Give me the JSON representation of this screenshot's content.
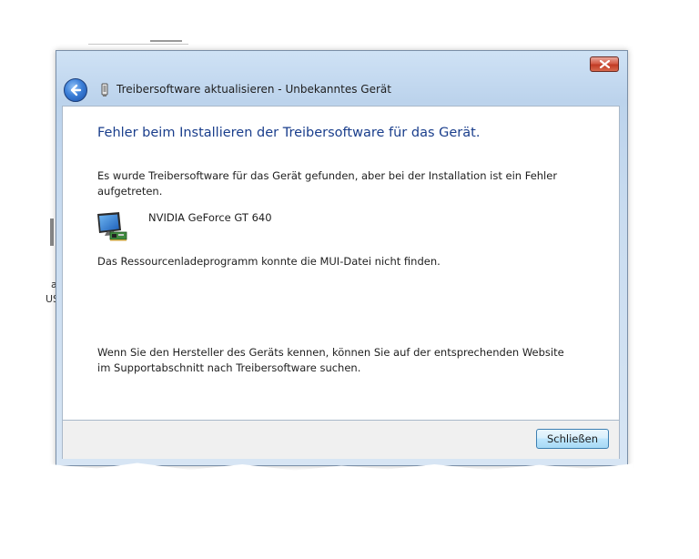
{
  "window": {
    "title": "Treibersoftware aktualisieren - Unbekanntes Gerät"
  },
  "background": {
    "fragment_a": "a",
    "fragment_b": "US"
  },
  "content": {
    "heading": "Fehler beim Installieren der Treibersoftware für das Gerät.",
    "intro": "Es wurde Treibersoftware für das Gerät gefunden, aber bei der Installation ist ein Fehler aufgetreten.",
    "device_name": "NVIDIA GeForce GT 640",
    "error_message": "Das Ressourcenladeprogramm konnte die MUI-Datei nicht finden.",
    "help_text": "Wenn Sie den Hersteller des Geräts kennen, können Sie auf der entsprechenden Website im Supportabschnitt nach Treibersoftware suchen."
  },
  "footer": {
    "close_label": "Schließen"
  },
  "icons": {
    "back": "back-arrow-icon",
    "title": "device-icon",
    "device": "display-adapter-icon",
    "close": "close-icon"
  },
  "colors": {
    "heading": "#1a3e8c",
    "close_button": "#c13b25",
    "back_button": "#3b7fd8"
  }
}
